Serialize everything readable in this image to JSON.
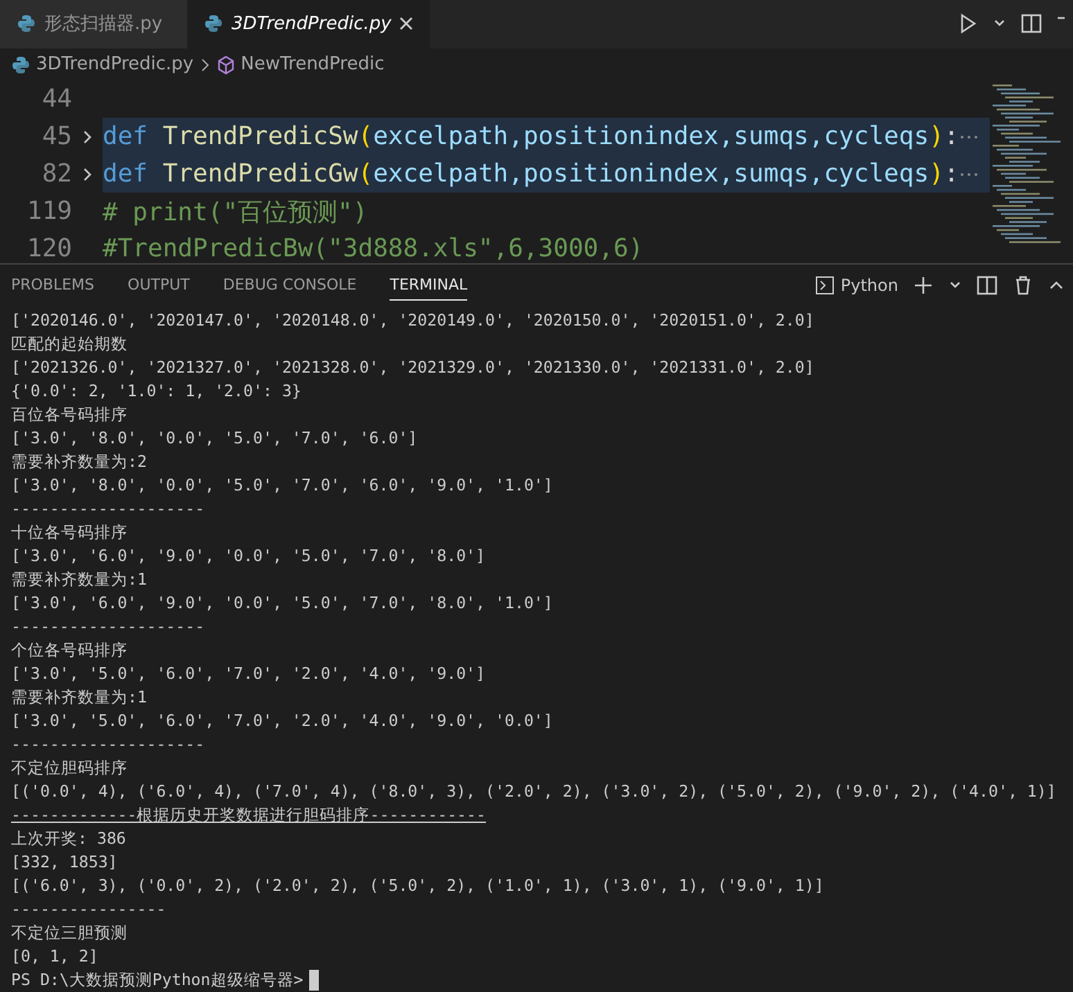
{
  "tabs": [
    {
      "label": "形态扫描器.py",
      "selected": false,
      "italic": false
    },
    {
      "label": "3DTrendPredic.py",
      "selected": true,
      "italic": true
    }
  ],
  "breadcrumb": {
    "file": "3DTrendPredic.py",
    "symbol": "NewTrendPredic"
  },
  "editor": {
    "lines": [
      {
        "number": "44",
        "folded": false
      },
      {
        "number": "45",
        "folded": true,
        "tokens": [
          {
            "kind": "keyword",
            "text": "def "
          },
          {
            "kind": "function",
            "text": "TrendPredicSw"
          },
          {
            "kind": "bracket",
            "text": "("
          },
          {
            "kind": "param",
            "text": "excelpath,positionindex,sumqs,cycleqs"
          },
          {
            "kind": "bracket",
            "text": ")"
          },
          {
            "kind": "plain",
            "text": ":"
          }
        ]
      },
      {
        "number": "82",
        "folded": true,
        "tokens": [
          {
            "kind": "keyword",
            "text": "def "
          },
          {
            "kind": "function",
            "text": "TrendPredicGw"
          },
          {
            "kind": "bracket",
            "text": "("
          },
          {
            "kind": "param",
            "text": "excelpath,positionindex,sumqs,cycleqs"
          },
          {
            "kind": "bracket",
            "text": ")"
          },
          {
            "kind": "plain",
            "text": ":"
          }
        ]
      },
      {
        "number": "119",
        "folded": false,
        "tokens": [
          {
            "kind": "comment",
            "text": "# print(\"百位预测\")"
          }
        ]
      },
      {
        "number": "120",
        "folded": false,
        "tokens": [
          {
            "kind": "comment",
            "text": "#TrendPredicBw(\"3d888.xls\",6,3000,6)"
          }
        ]
      }
    ]
  },
  "panel": {
    "tabs": [
      {
        "label": "PROBLEMS",
        "selected": false
      },
      {
        "label": "OUTPUT",
        "selected": false
      },
      {
        "label": "DEBUG CONSOLE",
        "selected": false
      },
      {
        "label": "TERMINAL",
        "selected": true
      }
    ],
    "shell": "Python"
  },
  "terminal": [
    {
      "kind": "output",
      "text": "['2020146.0', '2020147.0', '2020148.0', '2020149.0', '2020150.0', '2020151.0', 2.0]"
    },
    {
      "kind": "output",
      "text": "匹配的起始期数"
    },
    {
      "kind": "output",
      "text": "['2021326.0', '2021327.0', '2021328.0', '2021329.0', '2021330.0', '2021331.0', 2.0]"
    },
    {
      "kind": "output",
      "text": "{'0.0': 2, '1.0': 1, '2.0': 3}"
    },
    {
      "kind": "output",
      "text": "百位各号码排序"
    },
    {
      "kind": "output",
      "text": "['3.0', '8.0', '0.0', '5.0', '7.0', '6.0']"
    },
    {
      "kind": "output",
      "text": "需要补齐数量为:2"
    },
    {
      "kind": "output",
      "text": "['3.0', '8.0', '0.0', '5.0', '7.0', '6.0', '9.0', '1.0']"
    },
    {
      "kind": "output",
      "text": "--------------------"
    },
    {
      "kind": "output",
      "text": "十位各号码排序"
    },
    {
      "kind": "output",
      "text": "['3.0', '6.0', '9.0', '0.0', '5.0', '7.0', '8.0']"
    },
    {
      "kind": "output",
      "text": "需要补齐数量为:1"
    },
    {
      "kind": "output",
      "text": "['3.0', '6.0', '9.0', '0.0', '5.0', '7.0', '8.0', '1.0']"
    },
    {
      "kind": "output",
      "text": "--------------------"
    },
    {
      "kind": "output",
      "text": "个位各号码排序"
    },
    {
      "kind": "output",
      "text": "['3.0', '5.0', '6.0', '7.0', '2.0', '4.0', '9.0']"
    },
    {
      "kind": "output",
      "text": "需要补齐数量为:1"
    },
    {
      "kind": "output",
      "text": "['3.0', '5.0', '6.0', '7.0', '2.0', '4.0', '9.0', '0.0']"
    },
    {
      "kind": "output",
      "text": "--------------------"
    },
    {
      "kind": "output",
      "text": "不定位胆码排序"
    },
    {
      "kind": "output",
      "text": "[('0.0', 4), ('6.0', 4), ('7.0', 4), ('8.0', 3), ('2.0', 2), ('3.0', 2), ('5.0', 2), ('9.0', 2), ('4.0', 1)]"
    },
    {
      "kind": "heading",
      "text": "-------------根据历史开奖数据进行胆码排序------------"
    },
    {
      "kind": "output",
      "text": "上次开奖: 386"
    },
    {
      "kind": "output",
      "text": "[332, 1853]"
    },
    {
      "kind": "output",
      "text": "[('6.0', 3), ('0.0', 2), ('2.0', 2), ('5.0', 2), ('1.0', 1), ('3.0', 1), ('9.0', 1)]"
    },
    {
      "kind": "output",
      "text": "----------------"
    },
    {
      "kind": "output",
      "text": "不定位三胆预测"
    },
    {
      "kind": "output",
      "text": "[0, 1, 2]"
    },
    {
      "kind": "prompt",
      "text": "PS D:\\大数据预测Python超级缩号器>"
    }
  ]
}
